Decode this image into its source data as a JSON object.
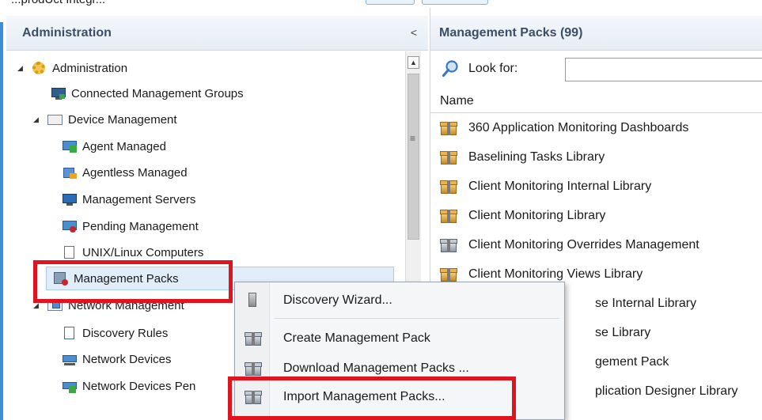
{
  "top_strip_text": "...prodUct Integr...",
  "left_panel": {
    "title": "Administration",
    "collapse_glyph": "<",
    "tree": [
      {
        "label": "Administration",
        "icon": "gear-icon",
        "expanded": true
      },
      {
        "label": "Connected Management Groups",
        "icon": "connected-groups-icon"
      },
      {
        "label": "Device Management",
        "icon": "device-management-icon",
        "expanded": true
      },
      {
        "label": "Agent Managed",
        "icon": "agent-managed-icon"
      },
      {
        "label": "Agentless Managed",
        "icon": "agentless-managed-icon"
      },
      {
        "label": "Management Servers",
        "icon": "management-servers-icon"
      },
      {
        "label": "Pending Management",
        "icon": "pending-management-icon"
      },
      {
        "label": "UNIX/Linux Computers",
        "icon": "unix-linux-icon"
      },
      {
        "label": "Management Packs",
        "icon": "management-packs-icon",
        "selected": true
      },
      {
        "label": "Network Management",
        "icon": "network-management-icon",
        "expanded": true
      },
      {
        "label": "Discovery Rules",
        "icon": "discovery-rules-icon"
      },
      {
        "label": "Network Devices",
        "icon": "network-devices-icon"
      },
      {
        "label": "Network Devices Pen",
        "icon": "network-devices-pending-icon"
      }
    ]
  },
  "right_panel": {
    "title": "Management Packs (99)",
    "search_label": "Look for:",
    "search_value": "",
    "column_header": "Name",
    "rows": [
      "360 Application Monitoring Dashboards",
      "Baselining Tasks Library",
      "Client Monitoring Internal Library",
      "Client Monitoring Library",
      "Client Monitoring Overrides Management",
      "Client Monitoring Views Library",
      "se Internal Library",
      "se Library",
      "gement Pack",
      "plication Designer Library"
    ]
  },
  "context_menu": {
    "items": [
      "Discovery Wizard...",
      "Create Management Pack",
      "Download Management Packs ...",
      "Import Management Packs..."
    ]
  },
  "colors": {
    "highlight": "#e0141e",
    "accent": "#3b8fd8",
    "header_text": "#3a4e66"
  }
}
